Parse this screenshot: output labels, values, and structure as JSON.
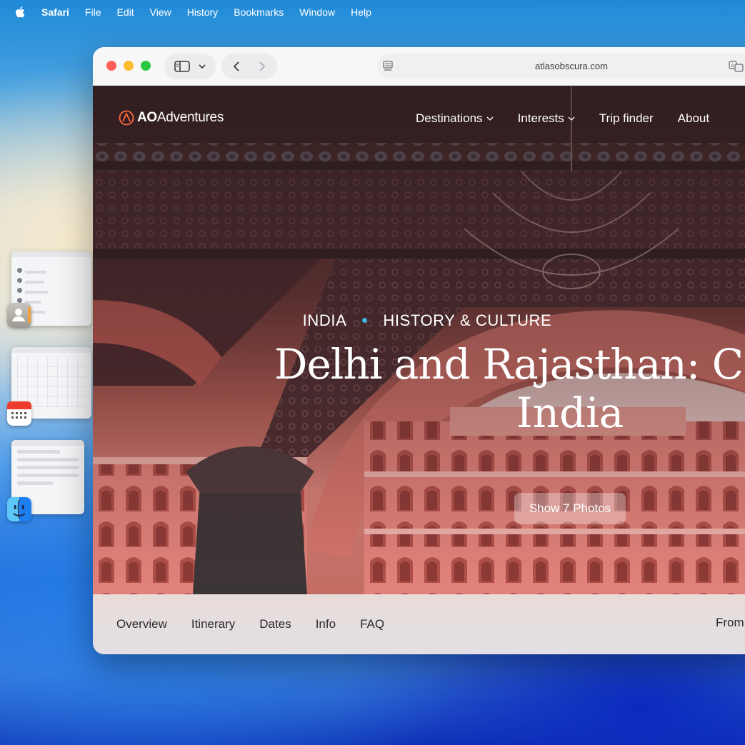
{
  "menubar": {
    "app_name": "Safari",
    "items": [
      "File",
      "Edit",
      "View",
      "History",
      "Bookmarks",
      "Window",
      "Help"
    ]
  },
  "browser": {
    "url": "atlasobscura.com"
  },
  "site": {
    "logo_bold": "AO",
    "logo_rest": "Adventures",
    "nav": {
      "destinations": "Destinations",
      "interests": "Interests",
      "trip_finder": "Trip finder",
      "about": "About"
    },
    "eyebrow": {
      "country": "INDIA",
      "category": "HISTORY & CULTURE"
    },
    "title_line1": "Delhi and Rajasthan: Co",
    "title_line2": "India",
    "photos_button": "Show 7 Photos",
    "subnav": [
      "Overview",
      "Itinerary",
      "Dates",
      "Info",
      "FAQ"
    ],
    "price_label": "From"
  },
  "colors": {
    "close": "#ff5f57",
    "minimize": "#febc2e",
    "zoom": "#28c840",
    "eyebrow_dot": "#3fb0d9"
  }
}
